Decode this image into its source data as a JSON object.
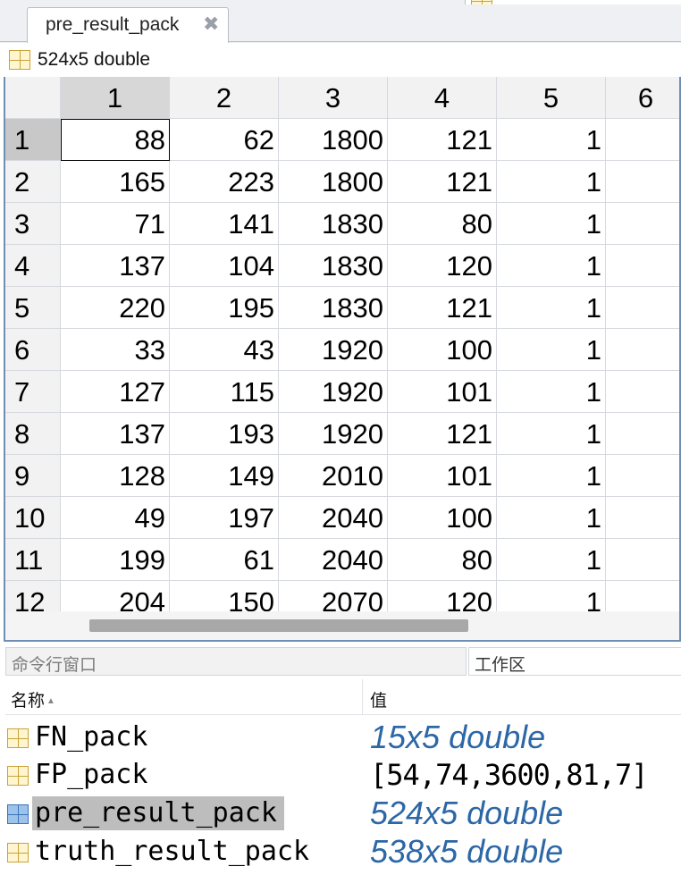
{
  "tab": {
    "title": "pre_result_pack",
    "close_glyph": "✖"
  },
  "variable": {
    "size_label": "524x5 double"
  },
  "grid": {
    "column_headers": [
      "1",
      "2",
      "3",
      "4",
      "5",
      "6"
    ],
    "active_column": 0,
    "rows": [
      {
        "label": "1",
        "cells": [
          "88",
          "62",
          "1800",
          "121",
          "1",
          ""
        ]
      },
      {
        "label": "2",
        "cells": [
          "165",
          "223",
          "1800",
          "121",
          "1",
          ""
        ]
      },
      {
        "label": "3",
        "cells": [
          "71",
          "141",
          "1830",
          "80",
          "1",
          ""
        ]
      },
      {
        "label": "4",
        "cells": [
          "137",
          "104",
          "1830",
          "120",
          "1",
          ""
        ]
      },
      {
        "label": "5",
        "cells": [
          "220",
          "195",
          "1830",
          "121",
          "1",
          ""
        ]
      },
      {
        "label": "6",
        "cells": [
          "33",
          "43",
          "1920",
          "100",
          "1",
          ""
        ]
      },
      {
        "label": "7",
        "cells": [
          "127",
          "115",
          "1920",
          "101",
          "1",
          ""
        ]
      },
      {
        "label": "8",
        "cells": [
          "137",
          "193",
          "1920",
          "121",
          "1",
          ""
        ]
      },
      {
        "label": "9",
        "cells": [
          "128",
          "149",
          "2010",
          "101",
          "1",
          ""
        ]
      },
      {
        "label": "10",
        "cells": [
          "49",
          "197",
          "2040",
          "100",
          "1",
          ""
        ]
      },
      {
        "label": "11",
        "cells": [
          "199",
          "61",
          "2040",
          "80",
          "1",
          ""
        ]
      },
      {
        "label": "12",
        "cells": [
          "204",
          "150",
          "2070",
          "120",
          "1",
          ""
        ]
      }
    ]
  },
  "panels": {
    "command_window": "命令行窗口",
    "workspace": "工作区"
  },
  "workspace": {
    "col_name": "名称",
    "col_value": "值",
    "variables": [
      {
        "name": "FN_pack",
        "value": "15x5 double",
        "kind": "meta",
        "selected": false
      },
      {
        "name": "FP_pack",
        "value": "[54,74,3600,81,7]",
        "kind": "literal",
        "selected": false
      },
      {
        "name": "pre_result_pack",
        "value": "524x5 double",
        "kind": "meta",
        "selected": true
      },
      {
        "name": "truth_result_pack",
        "value": "538x5 double",
        "kind": "meta",
        "selected": false
      }
    ]
  },
  "colors": {
    "meta_value": "#2c67a6",
    "selection": "#bdbdbd",
    "frame": "#6e8fb4"
  },
  "icons": {
    "variable": "matrix-grid-icon",
    "close": "close-icon",
    "sort": "sort-ascending-icon"
  }
}
